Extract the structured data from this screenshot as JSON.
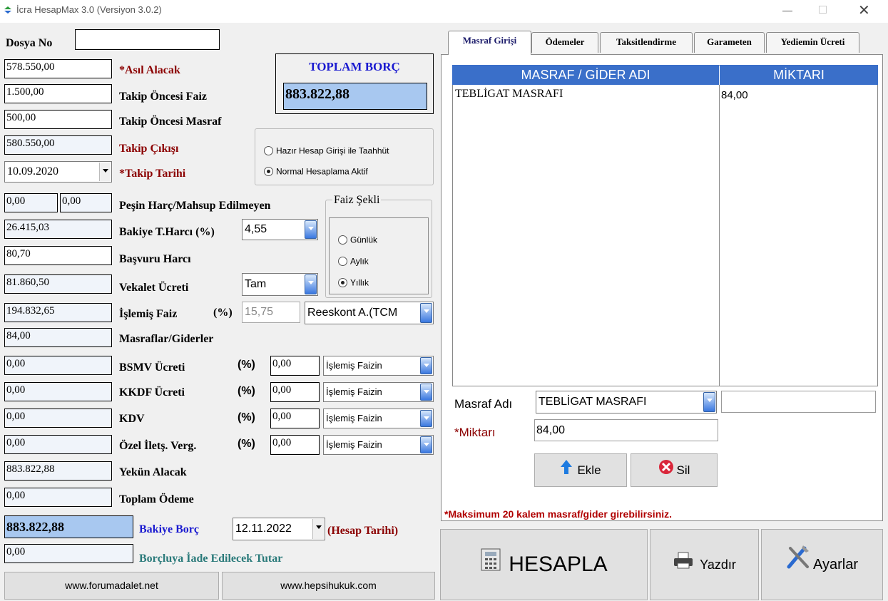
{
  "window": {
    "title": "İcra HesapMax 3.0 (Versiyon 3.0.2)"
  },
  "left": {
    "dosya_no": {
      "label": "Dosya No",
      "value": ""
    },
    "asil_alacak": {
      "label": "*Asıl Alacak",
      "value": "578.550,00"
    },
    "takip_oncesi_faiz": {
      "label": "Takip Öncesi Faiz",
      "value": "1.500,00"
    },
    "takip_oncesi_masraf": {
      "label": "Takip Öncesi Masraf",
      "value": "500,00"
    },
    "takip_cikisi": {
      "label": "Takip Çıkışı",
      "value": "580.550,00"
    },
    "takip_tarihi": {
      "label": "*Takip Tarihi",
      "value": "10.09.2020"
    },
    "pesin_harc": {
      "label": "Peşin Harç/Mahsup Edilmeyen",
      "value1": "0,00",
      "value2": "0,00"
    },
    "bakiye_harc": {
      "label": "Bakiye T.Harcı (%)",
      "value": "26.415,03",
      "rate": "4,55"
    },
    "basvuru_harci": {
      "label": "Başvuru Harcı",
      "value": "80,70"
    },
    "vekalet_ucreti": {
      "label": "Vekalet Ücreti",
      "value": "81.860,50",
      "option": "Tam"
    },
    "islemis_faiz": {
      "label": "İşlemiş Faiz",
      "pct": "(%)",
      "value": "194.832,65",
      "rate": "15,75",
      "option": "Reeskont A.(TCM"
    },
    "masraflar": {
      "label": "Masraflar/Giderler",
      "value": "84,00"
    },
    "bsmv": {
      "label": "BSMV Ücreti",
      "pct": "(%)",
      "value": "0,00",
      "rate": "0,00",
      "option": "İşlemiş Faizin"
    },
    "kkdf": {
      "label": "KKDF Ücreti",
      "pct": "(%)",
      "value": "0,00",
      "rate": "0,00",
      "option": "İşlemiş Faizin"
    },
    "kdv": {
      "label": "KDV",
      "pct": "(%)",
      "value": "0,00",
      "rate": "0,00",
      "option": "İşlemiş Faizin"
    },
    "ozel_iletisim": {
      "label": "Özel İletş. Verg.",
      "pct": "(%)",
      "value": "0,00",
      "rate": "0,00",
      "option": "İşlemiş Faizin"
    },
    "yekun_alacak": {
      "label": "Yekün Alacak",
      "value": "883.822,88"
    },
    "toplam_odeme": {
      "label": "Toplam Ödeme",
      "value": "0,00"
    },
    "bakiye_borc": {
      "label": "Bakiye Borç",
      "value": "883.822,88"
    },
    "hesap_tarihi": {
      "value": "12.11.2022",
      "label": "(Hesap Tarihi)"
    },
    "iade": {
      "label": "Borçluya İade Edilecek Tutar",
      "value": "0,00"
    },
    "toplam_borc": {
      "label": "TOPLAM BORÇ",
      "value": "883.822,88"
    },
    "mode": {
      "option1": "Hazır Hesap Girişi ile Taahhüt",
      "option2": "Normal Hesaplama Aktif",
      "selected": "option2"
    },
    "faiz_sekli": {
      "title": "Faiz Şekli",
      "options": [
        "Günlük",
        "Aylık",
        "Yıllık"
      ],
      "selected": "Yıllık"
    },
    "links": [
      "www.forumadalet.net",
      "www.hepsihukuk.com"
    ]
  },
  "tabs": [
    "Masraf Girişi",
    "Ödemeler",
    "Taksitlendirme",
    "Garameten",
    "Yediemin Ücreti"
  ],
  "active_tab": "Masraf Girişi",
  "table": {
    "headers": [
      "MASRAF / GİDER ADI",
      "MİKTARI"
    ],
    "rows": [
      [
        "TEBLİGAT MASRAFI",
        "84,00"
      ]
    ]
  },
  "form": {
    "masraf_adi_label": "Masraf Adı",
    "masraf_adi_value": "TEBLİGAT MASRAFI",
    "extra_value": "",
    "miktar_label": "*Miktarı",
    "miktar_value": "84,00",
    "add": "Ekle",
    "delete": "Sil",
    "note": "*Maksimum 20 kalem masraf/gider girebilirsiniz."
  },
  "actions": {
    "calculate": "HESAPLA",
    "print": "Yazdır",
    "settings": "Ayarlar"
  },
  "colors": {
    "header_blue": "#3a6fc9",
    "total_fill": "#a8c8f0",
    "dark_red": "#8b0000",
    "link_blue": "#1a1ad0"
  }
}
